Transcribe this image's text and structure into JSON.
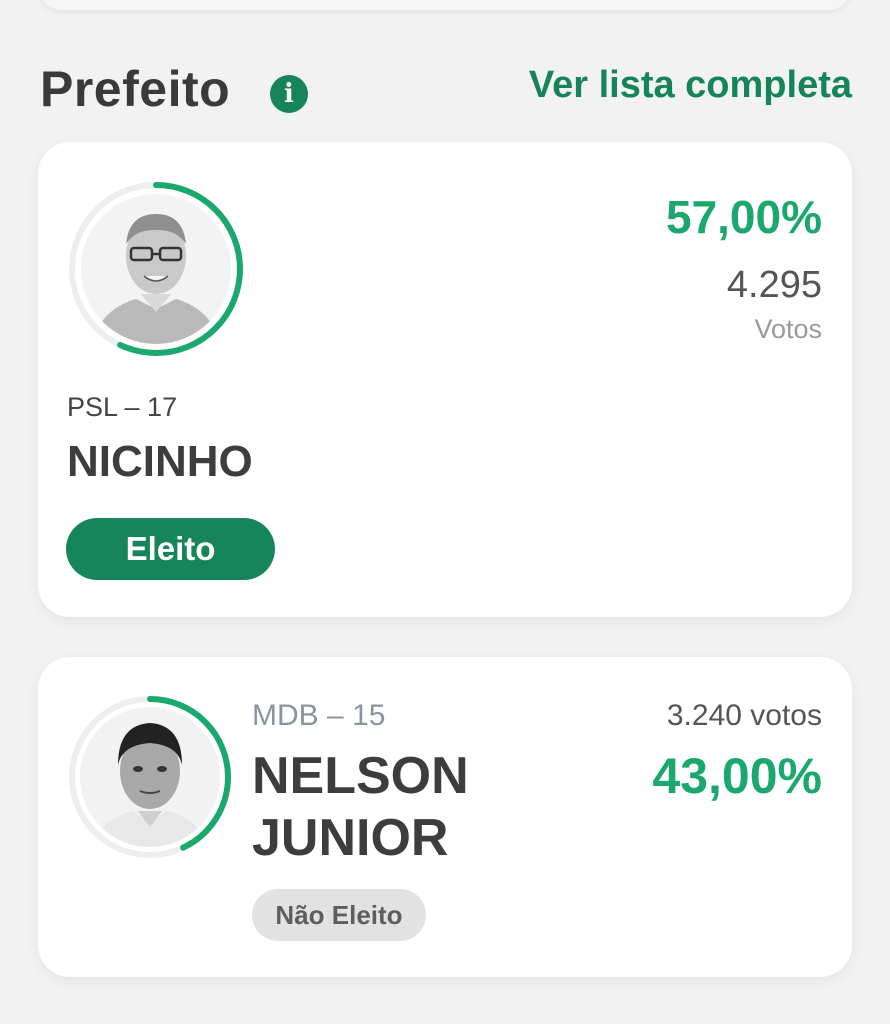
{
  "header": {
    "title": "Prefeito",
    "info_icon": "i",
    "see_all_label": "Ver lista completa"
  },
  "colors": {
    "brand_green": "#16845a",
    "percent_green": "#1aa86d",
    "ring_track": "#eeeeee"
  },
  "candidates": [
    {
      "party": "PSL – 17",
      "name": "NICINHO",
      "percent": "57,00%",
      "percent_value": 57.0,
      "votes": "4.295",
      "votes_label": "Votos",
      "status": "Eleito",
      "avatar_icon": "candidate-photo"
    },
    {
      "party": "MDB – 15",
      "name_line1": "NELSON",
      "name_line2": "JUNIOR",
      "percent": "43,00%",
      "percent_value": 43.0,
      "votes": "3.240 votos",
      "status": "Não Eleito",
      "avatar_icon": "candidate-photo"
    }
  ]
}
